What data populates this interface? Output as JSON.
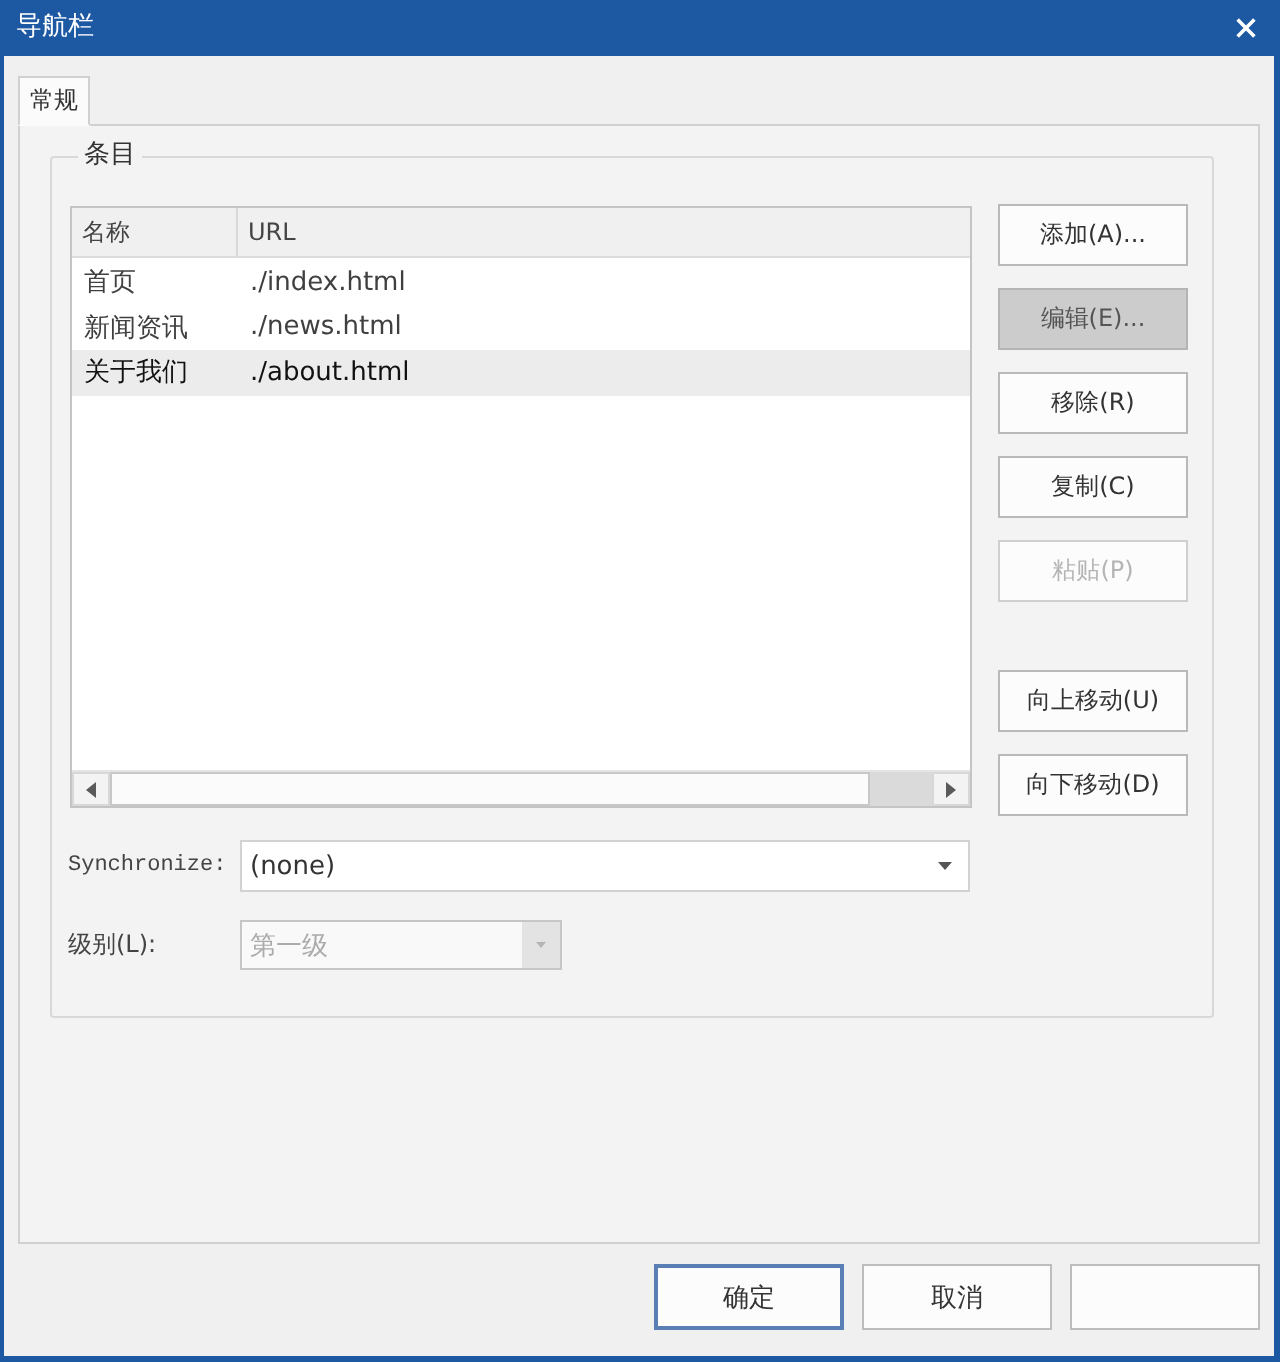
{
  "window": {
    "title": "导航栏"
  },
  "tabs": [
    {
      "label": "常规",
      "selected": true
    }
  ],
  "group": {
    "title": "条目"
  },
  "list": {
    "columns": [
      "名称",
      "URL"
    ],
    "rows": [
      {
        "name": "首页",
        "url": "./index.html",
        "selected": false
      },
      {
        "name": "新闻资讯",
        "url": "./news.html",
        "selected": false
      },
      {
        "name": "关于我们",
        "url": "./about.html",
        "selected": true
      }
    ]
  },
  "edit_buttons": [
    {
      "label": "添加(A)...",
      "pressed": false,
      "disabled": false
    },
    {
      "label": "编辑(E)...",
      "pressed": true,
      "disabled": false
    },
    {
      "label": "移除(R)",
      "pressed": false,
      "disabled": false
    },
    {
      "label": "复制(C)",
      "pressed": false,
      "disabled": false
    },
    {
      "label": "粘贴(P)",
      "pressed": false,
      "disabled": true
    }
  ],
  "move_buttons": [
    {
      "label": "向上移动(U)",
      "disabled": false
    },
    {
      "label": "向下移动(D)",
      "disabled": false
    }
  ],
  "synchronize": {
    "label": "Synchronize:",
    "value": "(none)",
    "disabled": false
  },
  "level": {
    "label": "级别(L):",
    "value": "第一级",
    "disabled": true
  },
  "footer_buttons": [
    {
      "label": "确定",
      "default": true
    },
    {
      "label": "取消",
      "default": false
    },
    {
      "default": false
    }
  ]
}
